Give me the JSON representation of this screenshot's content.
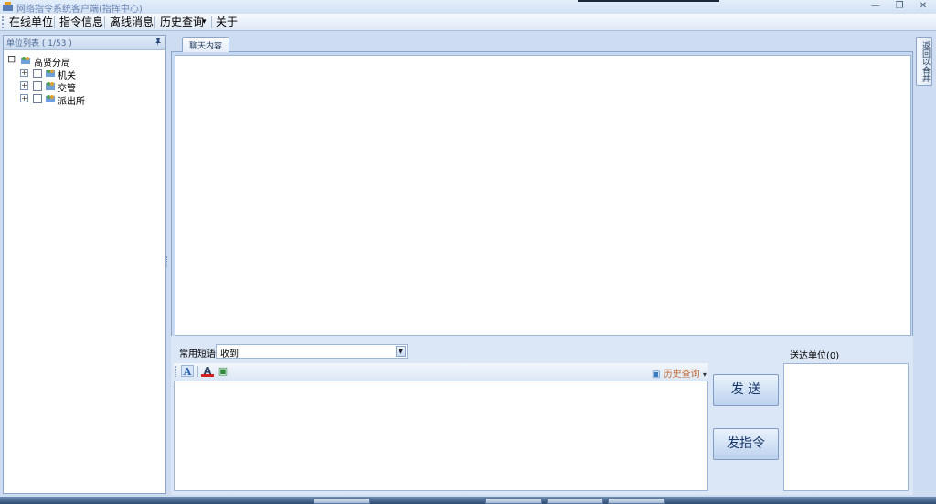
{
  "window": {
    "title": "网络指令系统客户端(指挥中心)",
    "controls": [
      "—",
      "❐",
      "✕"
    ]
  },
  "menu": {
    "items": [
      {
        "label": "在线单位"
      },
      {
        "label": "指令信息"
      },
      {
        "label": "离线消息"
      },
      {
        "label": "历史查询"
      },
      {
        "label": "关于"
      }
    ],
    "dropdown_arrow": "▾"
  },
  "left_pane": {
    "title": "单位列表 ( 1/53 )",
    "pin_glyph": "📌",
    "tree": {
      "root": {
        "label": "高贤分局",
        "expander": "⊟"
      },
      "children": [
        {
          "label": "机关",
          "expander": "+"
        },
        {
          "label": "交管",
          "expander": "+"
        },
        {
          "label": "派出所",
          "expander": "+"
        }
      ]
    }
  },
  "tabs": [
    {
      "label": "聊天内容"
    }
  ],
  "compose": {
    "phrases_label": "常用短语",
    "phrases_value": "收到",
    "dropdown_glyph": "▼",
    "toolbar": {
      "font_icon": "A",
      "color_icon": "A",
      "image_icon": "▣",
      "history_icon": "▣",
      "history_label": "历史查询"
    },
    "send_button": "发 送",
    "send_command_button": "发指令"
  },
  "recipients": {
    "label": "送达单位(0)"
  },
  "right_tab": {
    "label": "返回以合并"
  },
  "colors": {
    "accent": "#1e395b",
    "history_link": "#c0642b",
    "background": "#cddcf0"
  }
}
